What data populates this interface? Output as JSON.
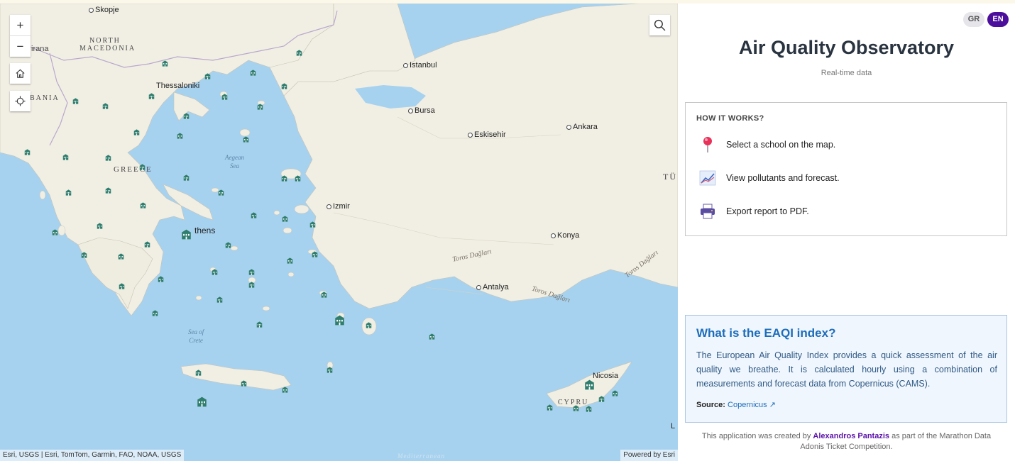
{
  "app": {
    "title": "Air Quality Observatory",
    "subtitle": "Real-time data",
    "lang_gr": "GR",
    "lang_en": "EN",
    "accent": "#4b0f9c"
  },
  "map": {
    "cities": [
      "Skopje",
      "Thessaloniki",
      "Istanbul",
      "Bursa",
      "Eskisehir",
      "Ankara",
      "Izmir",
      "Konya",
      "Antalya",
      "Nicosia"
    ],
    "athens_label": "thens",
    "countries": {
      "north_macedonia_1": "NORTH",
      "north_macedonia_2": "MACEDONIA",
      "albania": "BANIA",
      "greece": "GREECE",
      "tirana": "irana",
      "turkey": "TÜ",
      "cyprus": "CYPRU"
    },
    "seas": {
      "aegean_1": "Aegean",
      "aegean_2": "Sea",
      "crete_1": "Sea of",
      "crete_2": "Crete",
      "mediterranean": "Mediterranean"
    },
    "mountains": [
      "Toros Dağları",
      "Toros Dağları",
      "Toros Dağları"
    ],
    "edge_letter": "L",
    "attribution": "Esri, USGS | Esri, TomTom, Garmin, FAO, NOAA, USGS",
    "powered_by": "Powered by Esri",
    "controls": {
      "zoom_in": "+",
      "zoom_out": "−"
    }
  },
  "how_it_works": {
    "heading": "HOW IT WORKS?",
    "steps": [
      {
        "icon": "map-pin-icon",
        "label": "Select a school on the map."
      },
      {
        "icon": "line-chart-icon",
        "label": "View pollutants and forecast."
      },
      {
        "icon": "printer-icon",
        "label": "Export report to PDF."
      }
    ]
  },
  "eaqi": {
    "heading": "What is the EAQI index?",
    "body": "The European Air Quality Index provides a quick assessment of the air quality we breathe. It is calculated hourly using a combination of measurements and forecast data from Copernicus (CAMS).",
    "source_label": "Source:",
    "source_link": "Copernicus ↗"
  },
  "credit": {
    "prefix": "This application was created by",
    "author": "Alexandros Pantazis",
    "suffix": "as part of the Marathon Data Adonis Ticket Competition."
  },
  "colors": {
    "sea": "#a7d2ef",
    "land": "#f1efe4",
    "school_marker": "#2f7d6d",
    "eaqi_title": "#1d6dbb"
  }
}
